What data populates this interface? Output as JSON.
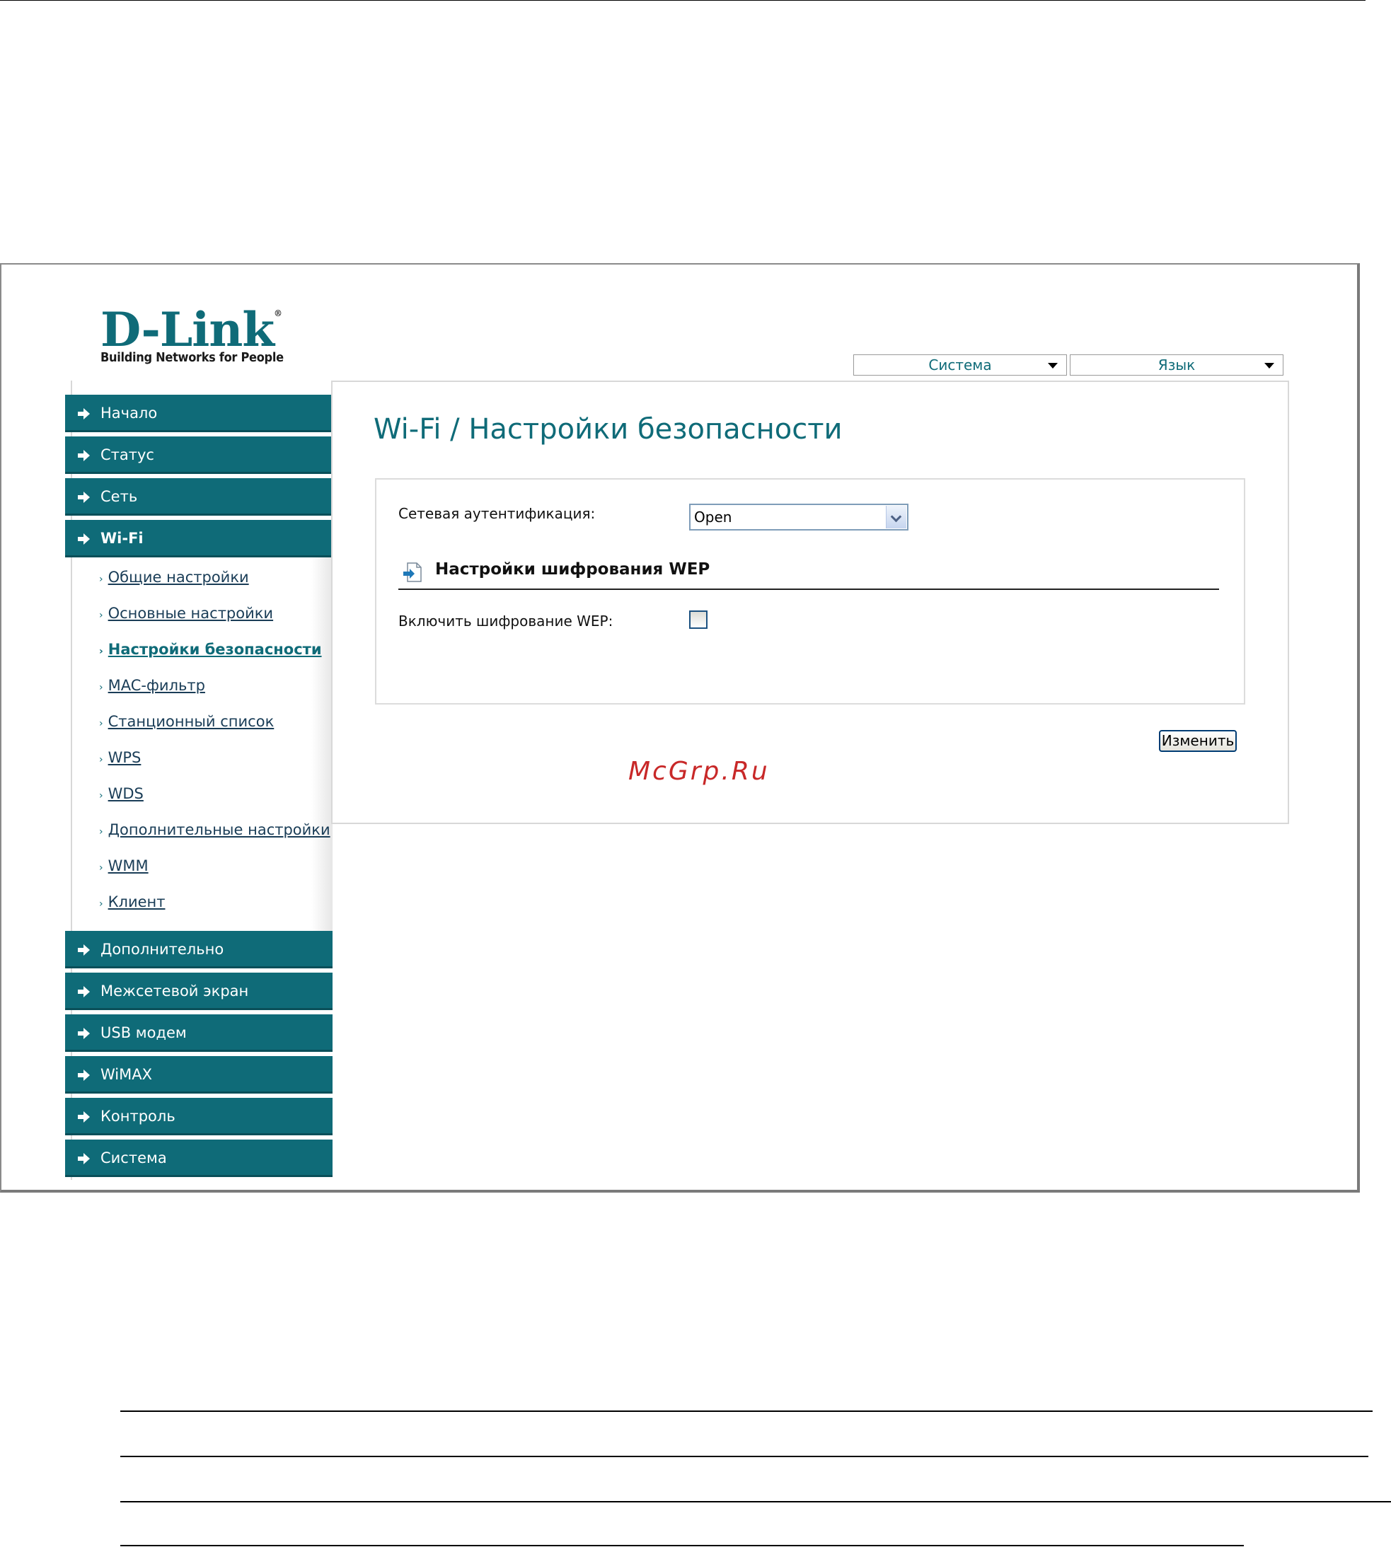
{
  "logo": {
    "brand": "D-Link",
    "trademark": "®",
    "slogan": "Building Networks for People"
  },
  "top_menu": {
    "system": "Система",
    "language": "Язык"
  },
  "sidebar": {
    "top_items": [
      {
        "label": "Начало"
      },
      {
        "label": "Статус"
      },
      {
        "label": "Сеть"
      },
      {
        "label": "Wi-Fi"
      }
    ],
    "wifi_subitems": [
      {
        "label": "Общие настройки"
      },
      {
        "label": "Основные настройки"
      },
      {
        "label": "Настройки безопасности"
      },
      {
        "label": "MAC-фильтр"
      },
      {
        "label": "Станционный список"
      },
      {
        "label": "WPS"
      },
      {
        "label": "WDS"
      },
      {
        "label": "Дополнительные настройки"
      },
      {
        "label": "WMM"
      },
      {
        "label": "Клиент"
      }
    ],
    "bottom_items": [
      {
        "label": "Дополнительно"
      },
      {
        "label": "Межсетевой экран"
      },
      {
        "label": "USB модем"
      },
      {
        "label": "WiMAX"
      },
      {
        "label": "Контроль"
      },
      {
        "label": "Система"
      }
    ]
  },
  "main": {
    "title": "Wi-Fi  / Настройки безопасности",
    "auth_label": "Сетевая аутентификация:",
    "auth_value": "Open",
    "wep_section_title": "Настройки шифрования WEP",
    "wep_enable_label": "Включить шифрование WEP:",
    "wep_enabled": false,
    "apply_button": "Изменить"
  },
  "watermark": "McGrp.Ru",
  "colors": {
    "accent": "#0f6b78",
    "watermark": "#c82828"
  }
}
